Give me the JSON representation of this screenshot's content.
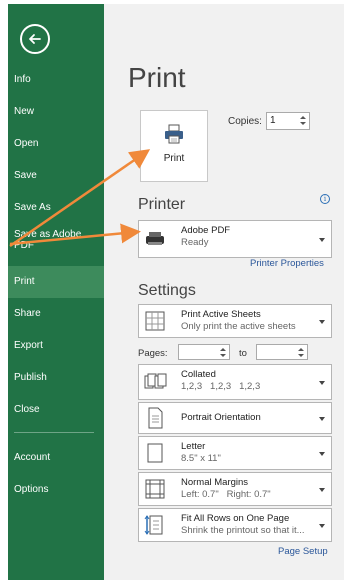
{
  "sidebar": {
    "items": [
      {
        "label": "Info"
      },
      {
        "label": "New"
      },
      {
        "label": "Open"
      },
      {
        "label": "Save"
      },
      {
        "label": "Save As"
      },
      {
        "label": "Save as Adobe PDF"
      },
      {
        "label": "Print"
      },
      {
        "label": "Share"
      },
      {
        "label": "Export"
      },
      {
        "label": "Publish"
      },
      {
        "label": "Close"
      },
      {
        "label": "Account"
      },
      {
        "label": "Options"
      }
    ]
  },
  "main": {
    "title": "Print",
    "print_button_label": "Print",
    "copies_label": "Copies:",
    "copies_value": "1",
    "printer_section": "Printer",
    "printer_name": "Adobe PDF",
    "printer_status": "Ready",
    "printer_properties_link": "Printer Properties",
    "settings_section": "Settings",
    "settings": [
      {
        "title": "Print Active Sheets",
        "subtitle": "Only print the active sheets"
      },
      {
        "title": "Collated",
        "subtitle": "1,2,3   1,2,3   1,2,3"
      },
      {
        "title": "Portrait Orientation",
        "subtitle": ""
      },
      {
        "title": "Letter",
        "subtitle": "8.5\" x 11\""
      },
      {
        "title": "Normal Margins",
        "subtitle": "Left: 0.7\"   Right: 0.7\""
      },
      {
        "title": "Fit All Rows on One Page",
        "subtitle": "Shrink the printout so that it..."
      }
    ],
    "pages_label": "Pages:",
    "to_label": "to",
    "page_setup_link": "Page Setup"
  },
  "colors": {
    "sidebar_bg": "#217346",
    "sidebar_active": "#3d8b5c",
    "main_bg": "#f1f1f1",
    "link": "#2b579a",
    "annotation_arrow": "#f0893a"
  }
}
